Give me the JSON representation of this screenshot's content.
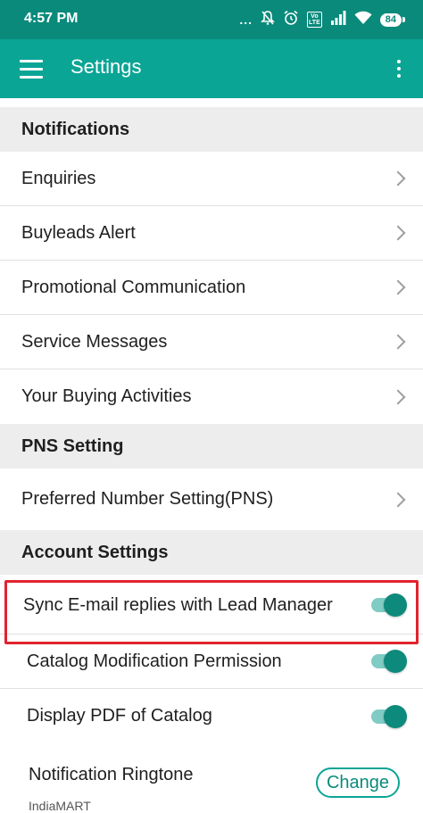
{
  "status_bar": {
    "time": "4:57 PM",
    "dots": "...",
    "volte": "VoLTE",
    "battery": "84",
    "icons": [
      "mute-icon",
      "alarm-icon",
      "volte-icon",
      "signal-icon",
      "wifi-icon",
      "battery-icon"
    ]
  },
  "app_bar": {
    "title": "Settings",
    "background": "#0aa595"
  },
  "sections": {
    "notifications": {
      "header": "Notifications",
      "items": [
        "Enquiries",
        "Buyleads Alert",
        "Promotional Communication",
        "Service Messages",
        "Your Buying Activities"
      ]
    },
    "pns": {
      "header": "PNS Setting",
      "items": [
        "Preferred Number Setting(PNS)"
      ]
    },
    "account": {
      "header": "Account Settings",
      "toggles": [
        {
          "label": "Sync E-mail replies with Lead Manager",
          "on": true
        },
        {
          "label": "Catalog Modification Permission",
          "on": true
        },
        {
          "label": "Display PDF of Catalog",
          "on": true
        }
      ],
      "ringtone": {
        "label": "Notification Ringtone",
        "value": "IndiaMART",
        "button": "Change"
      }
    }
  },
  "colors": {
    "accent": "#0aa595",
    "status_bar": "#0a8a7b",
    "highlight_border": "#e0242e",
    "toggle_thumb": "#0e8a7c",
    "toggle_track": "#80cbc4"
  }
}
